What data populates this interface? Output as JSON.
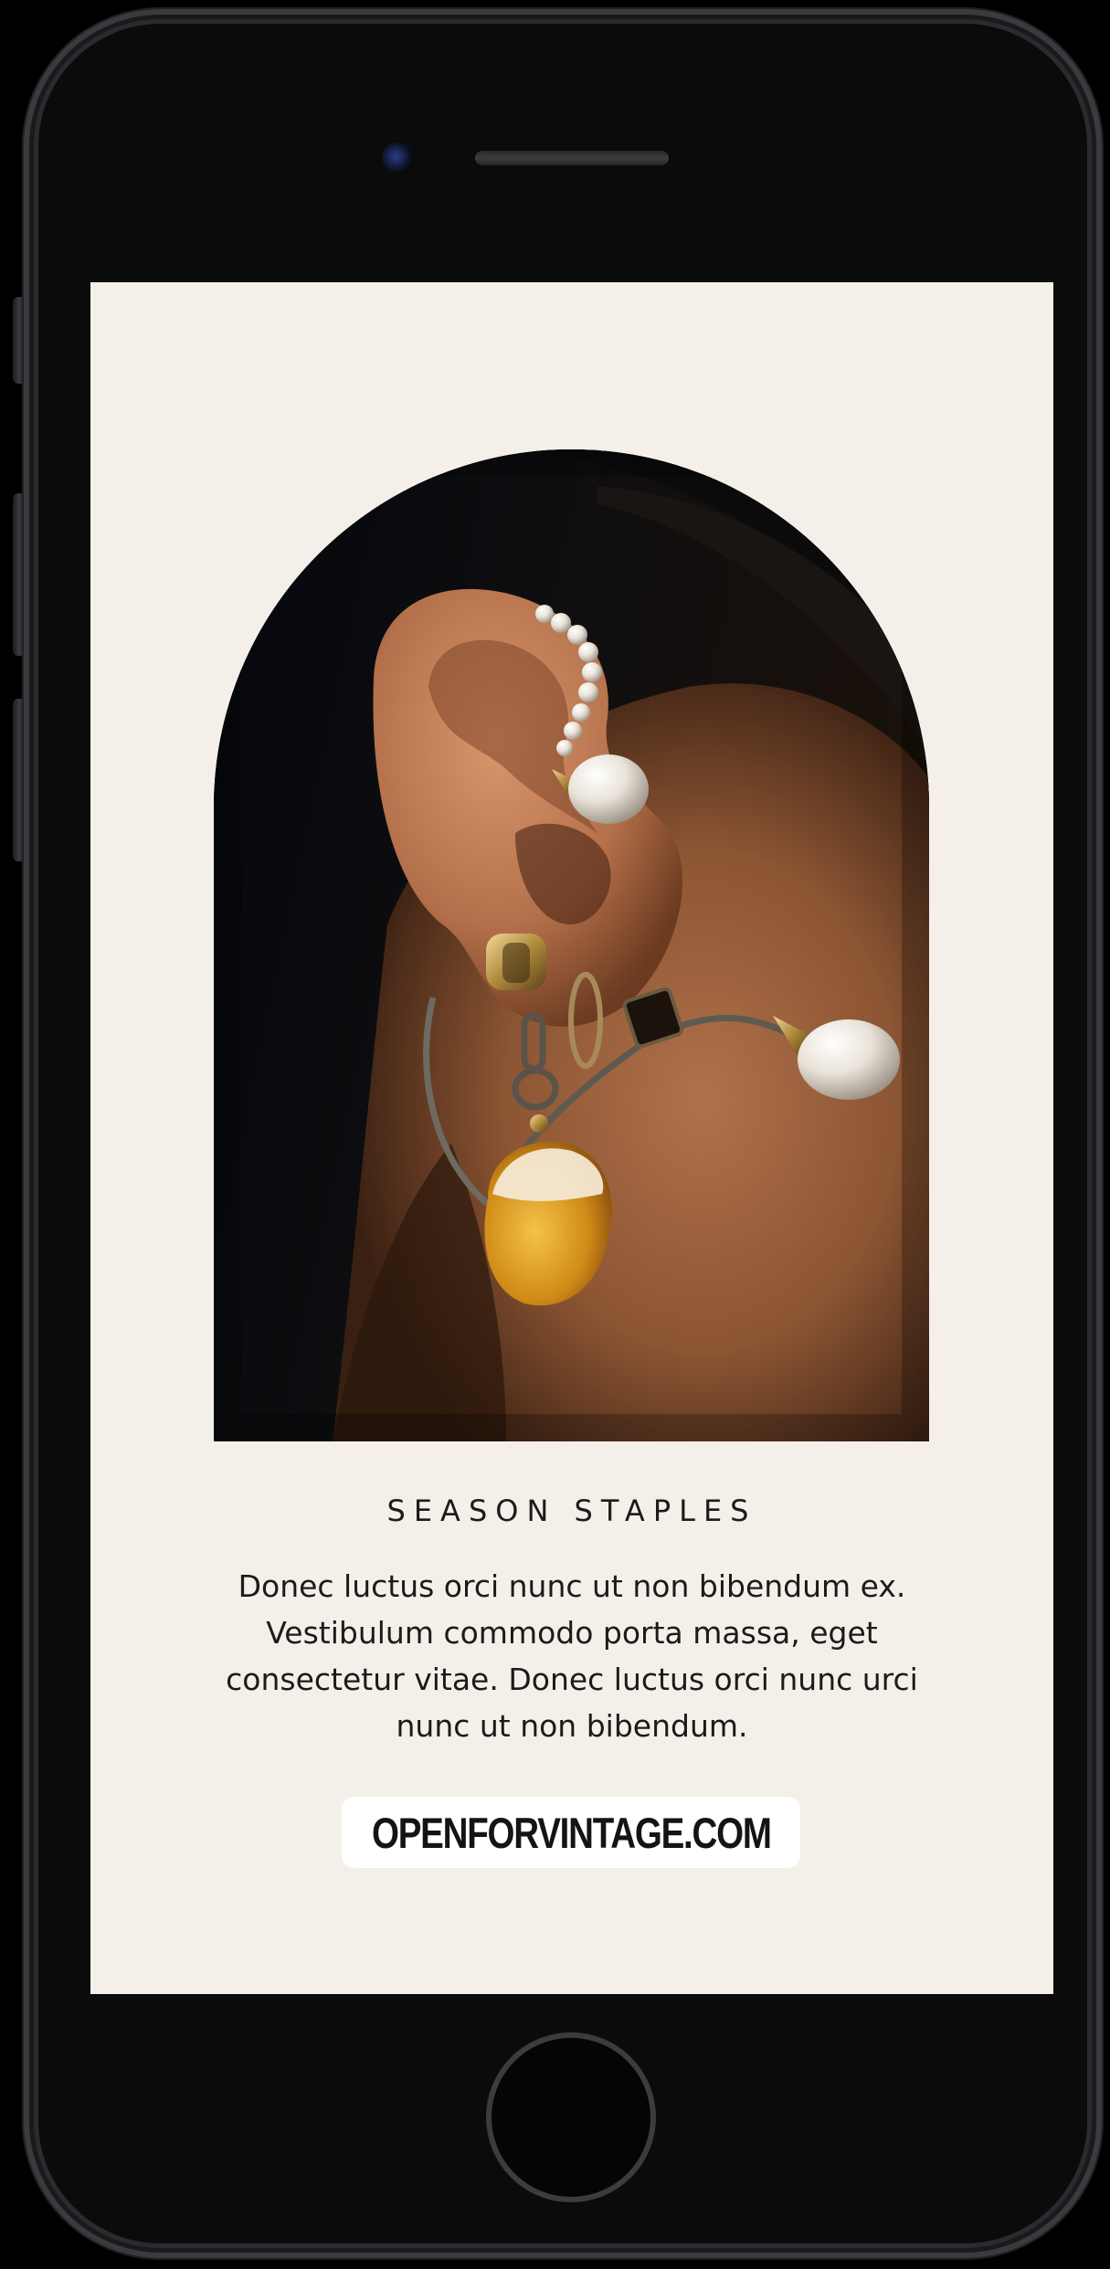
{
  "story": {
    "headline": "SEASON STAPLES",
    "body": "Donec luctus orci nunc ut non bibendum ex. Vestibulum commodo porta massa, eget consectetur vitae. Donec luctus orci nunc urci nunc ut non bibendum.",
    "cta_label": "OPENFORVINTAGE.COM"
  },
  "colors": {
    "screen_background": "#f4f0e9",
    "text": "#1c1b19",
    "cta_background": "#ffffff",
    "device_frame": "#0b0b0c"
  }
}
